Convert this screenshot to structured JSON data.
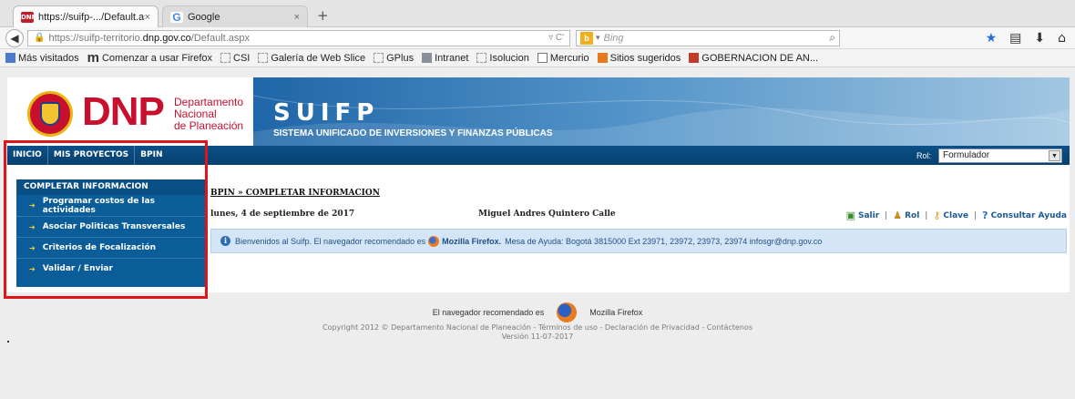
{
  "browser": {
    "tabs": [
      {
        "title": "https://suifp-.../Default.aspx",
        "close": "×",
        "favicon": "dnp-favicon"
      },
      {
        "title": "Google",
        "close": "×",
        "favicon": "google-favicon"
      }
    ],
    "new_tab": "+",
    "url_prefix": "https://suifp-territorio.",
    "url_domain": "dnp.gov.co",
    "url_suffix": "/Default.aspx",
    "url_reload": "▿ C'",
    "search_placeholder": "Bing",
    "bing_logo": "b",
    "bookmarks": [
      {
        "label": "Más visitados",
        "icon": "bookmark-folder-icon"
      },
      {
        "label": "Comenzar a usar Firefox",
        "icon": "msn-icon"
      },
      {
        "label": "CSI",
        "icon": "page-icon"
      },
      {
        "label": "Galería de Web Slice",
        "icon": "page-icon"
      },
      {
        "label": "GPlus",
        "icon": "page-icon"
      },
      {
        "label": "Intranet",
        "icon": "intranet-icon"
      },
      {
        "label": "Isolucion",
        "icon": "page-icon"
      },
      {
        "label": "Mercurio",
        "icon": "chart-icon"
      },
      {
        "label": "Sitios sugeridos",
        "icon": "suggested-sites-icon"
      },
      {
        "label": "GOBERNACION DE AN...",
        "icon": "gobernacion-icon"
      }
    ]
  },
  "header": {
    "dnp_logo": "DNP",
    "dnp_sub": [
      "Departamento",
      "Nacional",
      "de Planeación"
    ],
    "app_name": "SUIFP",
    "app_subtitle": "SISTEMA UNIFICADO DE INVERSIONES Y FINANZAS PÚBLICAS"
  },
  "menu": {
    "items": [
      "INICIO",
      "MIS PROYECTOS",
      "BPIN"
    ],
    "rol_label": "Rol:",
    "rol_value": "Formulador"
  },
  "left_panel": {
    "title": "COMPLETAR INFORMACION",
    "items": [
      "Programar costos de las actividades",
      "Asociar Politicas Transversales",
      "Criterios de Focalización",
      "Validar / Enviar"
    ]
  },
  "main": {
    "breadcrumb": "BPIN » COMPLETAR INFORMACION",
    "date": "lunes, 4 de septiembre de 2017",
    "user": "Miguel Andres Quintero Calle",
    "actions": [
      {
        "label": "Salir",
        "icon": "exit-icon"
      },
      {
        "label": "Rol",
        "icon": "users-icon"
      },
      {
        "label": "Clave",
        "icon": "key-icon"
      },
      {
        "label": "Consultar Ayuda",
        "icon": "help-icon"
      }
    ],
    "action_separator": "|",
    "welcome_before": "Bienvenidos al Suifp. El navegador recomendado es",
    "welcome_brand": "Mozilla Firefox.",
    "welcome_after": "Mesa de Ayuda: Bogotá 3815000 Ext 23971, 23972, 23973, 23974 infosgr@dnp.gov.co"
  },
  "footer": {
    "line1_before": "El navegador recomendado es",
    "line1_after": "Mozilla Firefox",
    "line2": "Copyright 2012 © Departamento Nacional de Planeación - Términos de uso - Declaración de Privacidad - Contáctenos",
    "line3": "Versión 11-07-2017"
  },
  "colors": {
    "menu_bar": "#0c5088",
    "left_panel": "#0b5d9a",
    "highlight_box": "#e0141b",
    "dnp_red": "#c8102e"
  }
}
